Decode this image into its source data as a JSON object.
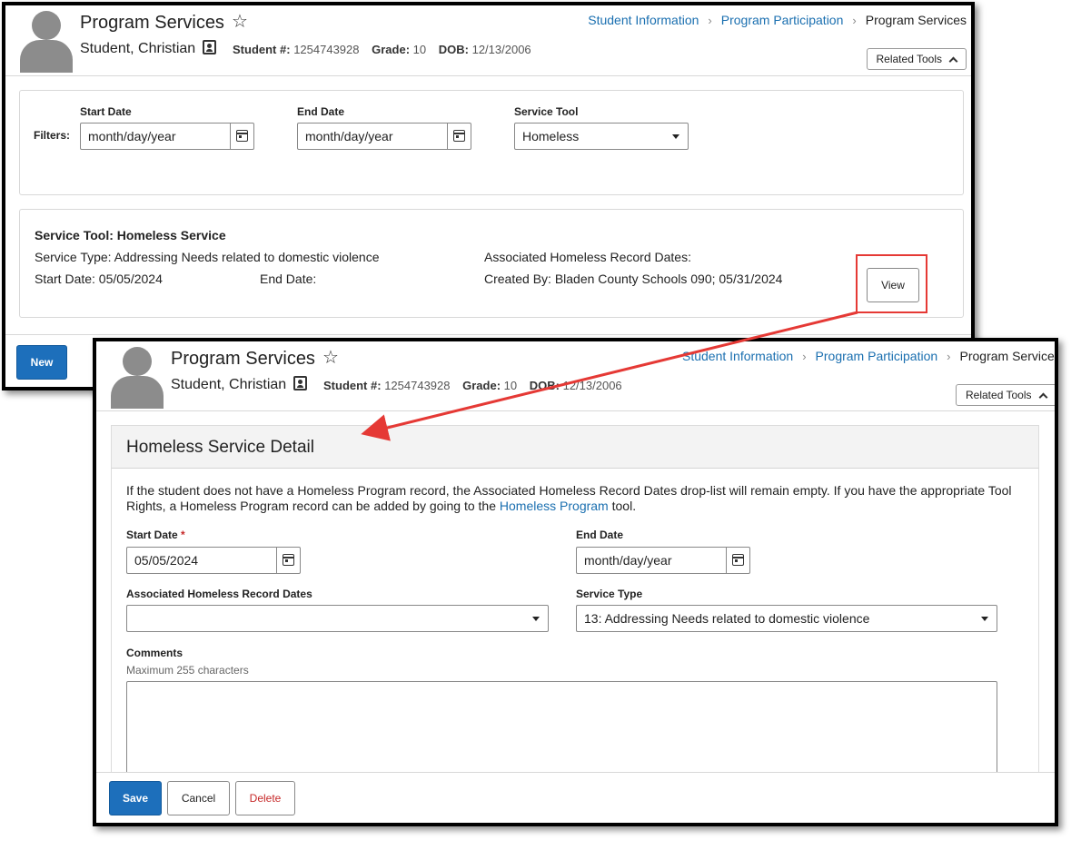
{
  "back": {
    "title": "Program Services",
    "student": {
      "name": "Student, Christian",
      "number_label": "Student #:",
      "number": "1254743928",
      "grade_label": "Grade:",
      "grade": "10",
      "dob_label": "DOB:",
      "dob": "12/13/2006"
    },
    "breadcrumb": [
      "Student Information",
      "Program Participation",
      "Program Services"
    ],
    "related_tools": "Related Tools",
    "filters": {
      "label": "Filters:",
      "start_label": "Start Date",
      "start_placeholder": "month/day/year",
      "end_label": "End Date",
      "end_placeholder": "month/day/year",
      "tool_label": "Service Tool",
      "tool_value": "Homeless"
    },
    "service": {
      "heading": "Service Tool: Homeless Service",
      "type": "Service Type: Addressing Needs related to domestic violence",
      "start": "Start Date: 05/05/2024",
      "end": "End Date:",
      "assoc": "Associated Homeless Record Dates:",
      "created": "Created By: Bladen County Schools 090; 05/31/2024",
      "view_button": "View"
    },
    "new_button": "New"
  },
  "front": {
    "title": "Program Services",
    "student": {
      "name": "Student, Christian",
      "number_label": "Student #:",
      "number": "1254743928",
      "grade_label": "Grade:",
      "grade": "10",
      "dob_label": "DOB:",
      "dob": "12/13/2006"
    },
    "breadcrumb": [
      "Student Information",
      "Program Participation",
      "Program Service"
    ],
    "related_tools": "Related Tools",
    "detail": {
      "heading": "Homeless Service Detail",
      "info_text": "If the student does not have a Homeless Program record, the Associated Homeless Record Dates drop-list will remain empty. If you have the appropriate Tool Rights, a Homeless Program record can be added by going to the",
      "info_link": "Homeless Program",
      "info_tail": "tool.",
      "start_label": "Start Date",
      "required_mark": "*",
      "start_value": "05/05/2024",
      "end_label": "End Date",
      "end_placeholder": "month/day/year",
      "assoc_label": "Associated Homeless Record Dates",
      "assoc_value": "",
      "type_label": "Service Type",
      "type_value": "13: Addressing Needs related to domestic violence",
      "comments_label": "Comments",
      "comments_hint": "Maximum 255 characters",
      "comments_value": ""
    },
    "buttons": {
      "save": "Save",
      "cancel": "Cancel",
      "delete": "Delete"
    }
  },
  "annotation": {
    "highlight_color": "#e53935",
    "link_color": "#1a6fb0",
    "primary_color": "#1d6fbb"
  }
}
